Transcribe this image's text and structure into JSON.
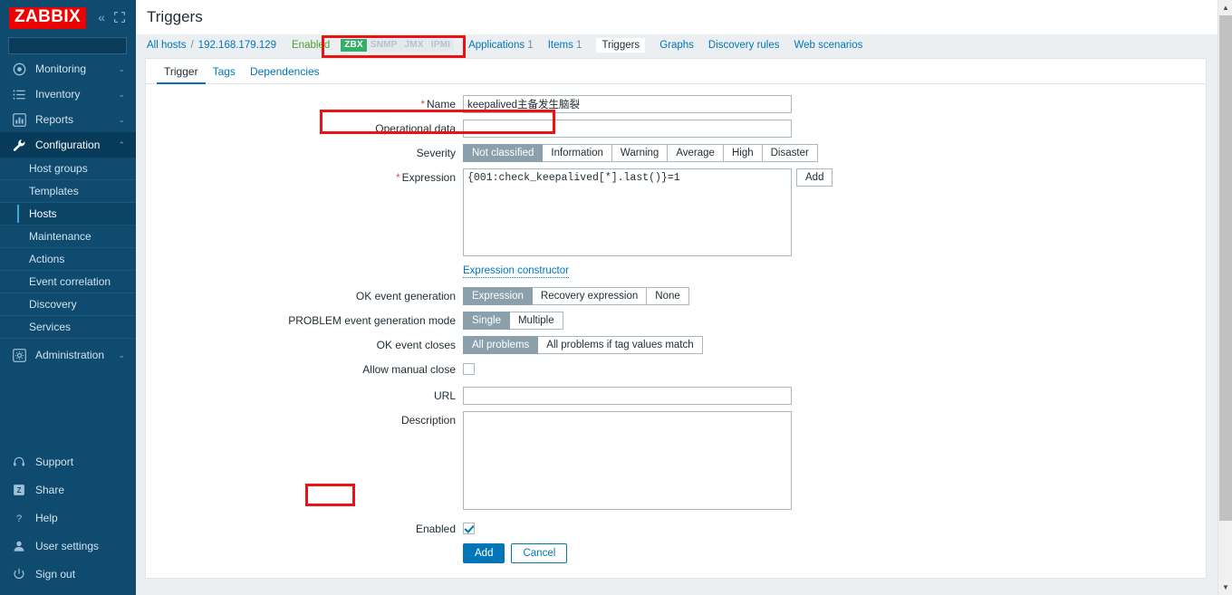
{
  "sidebar": {
    "logo": "ZABBIX",
    "collapse_icon": "chevron-double-left-icon",
    "kiosk_icon": "kiosk-mode-icon",
    "search": {
      "value": "",
      "placeholder": ""
    },
    "nav": [
      {
        "label": "Monitoring",
        "icon": "eye-icon",
        "active": false,
        "chevron": "⌄"
      },
      {
        "label": "Inventory",
        "icon": "list-icon",
        "active": false,
        "chevron": "⌄"
      },
      {
        "label": "Reports",
        "icon": "bar-chart-icon",
        "active": false,
        "chevron": "⌄"
      },
      {
        "label": "Configuration",
        "icon": "wrench-icon",
        "active": true,
        "chevron": "⌃"
      }
    ],
    "sub_items": [
      {
        "label": "Host groups",
        "selected": false
      },
      {
        "label": "Templates",
        "selected": false
      },
      {
        "label": "Hosts",
        "selected": true
      },
      {
        "label": "Maintenance",
        "selected": false
      },
      {
        "label": "Actions",
        "selected": false
      },
      {
        "label": "Event correlation",
        "selected": false
      },
      {
        "label": "Discovery",
        "selected": false
      },
      {
        "label": "Services",
        "selected": false
      }
    ],
    "admin": {
      "label": "Administration",
      "icon": "cog-square-icon",
      "chevron": "⌄"
    },
    "bottom": [
      {
        "label": "Support",
        "icon": "headset-icon"
      },
      {
        "label": "Share",
        "icon": "share-z-icon"
      },
      {
        "label": "Help",
        "icon": "question-icon"
      },
      {
        "label": "User settings",
        "icon": "person-icon"
      },
      {
        "label": "Sign out",
        "icon": "power-icon"
      }
    ]
  },
  "header": {
    "title": "Triggers"
  },
  "breadcrumb": {
    "all_hosts": "All hosts",
    "separator": "/",
    "host": "192.168.179.129",
    "status": "Enabled",
    "badges": [
      {
        "label": "ZBX",
        "enabled": true
      },
      {
        "label": "SNMP",
        "enabled": false
      },
      {
        "label": "JMX",
        "enabled": false
      },
      {
        "label": "IPMI",
        "enabled": false
      }
    ],
    "links": [
      {
        "label": "Applications",
        "count": "1",
        "current": false
      },
      {
        "label": "Items",
        "count": "1",
        "current": false
      },
      {
        "label": "Triggers",
        "count": "",
        "current": true
      },
      {
        "label": "Graphs",
        "count": "",
        "current": false
      },
      {
        "label": "Discovery rules",
        "count": "",
        "current": false
      },
      {
        "label": "Web scenarios",
        "count": "",
        "current": false
      }
    ]
  },
  "tabs": [
    {
      "label": "Trigger",
      "active": true
    },
    {
      "label": "Tags",
      "active": false
    },
    {
      "label": "Dependencies",
      "active": false
    }
  ],
  "form": {
    "name": {
      "label": "Name",
      "required": true,
      "value": "keepalived主备发生脑裂",
      "placeholder": ""
    },
    "operational_data": {
      "label": "Operational data",
      "value": "",
      "placeholder": ""
    },
    "severity": {
      "label": "Severity",
      "options": [
        "Not classified",
        "Information",
        "Warning",
        "Average",
        "High",
        "Disaster"
      ],
      "selected": "Not classified"
    },
    "expression": {
      "label": "Expression",
      "required": true,
      "value": "{001:check_keepalived[*].last()}=1",
      "add_button": "Add",
      "constructor_link": "Expression constructor"
    },
    "ok_event_generation": {
      "label": "OK event generation",
      "options": [
        "Expression",
        "Recovery expression",
        "None"
      ],
      "selected": "Expression"
    },
    "problem_event_generation_mode": {
      "label": "PROBLEM event generation mode",
      "options": [
        "Single",
        "Multiple"
      ],
      "selected": "Single"
    },
    "ok_event_closes": {
      "label": "OK event closes",
      "options": [
        "All problems",
        "All problems if tag values match"
      ],
      "selected": "All problems"
    },
    "allow_manual_close": {
      "label": "Allow manual close",
      "checked": false
    },
    "url": {
      "label": "URL",
      "value": "",
      "placeholder": ""
    },
    "description": {
      "label": "Description",
      "value": "",
      "placeholder": ""
    },
    "enabled": {
      "label": "Enabled",
      "checked": true
    },
    "submit": "Add",
    "cancel": "Cancel"
  },
  "annotations": {
    "highlight_color": "#ee1111",
    "boxes": [
      "name-field",
      "expression-field",
      "add-button"
    ]
  },
  "colors": {
    "sidebar_bg": "#0f4b6e",
    "logo_bg": "#ee0000",
    "accent_link": "#0275b8",
    "status_enabled": "#4ea02e",
    "badge_on": "#34af67",
    "seg_selected": "#8ba0ad"
  }
}
